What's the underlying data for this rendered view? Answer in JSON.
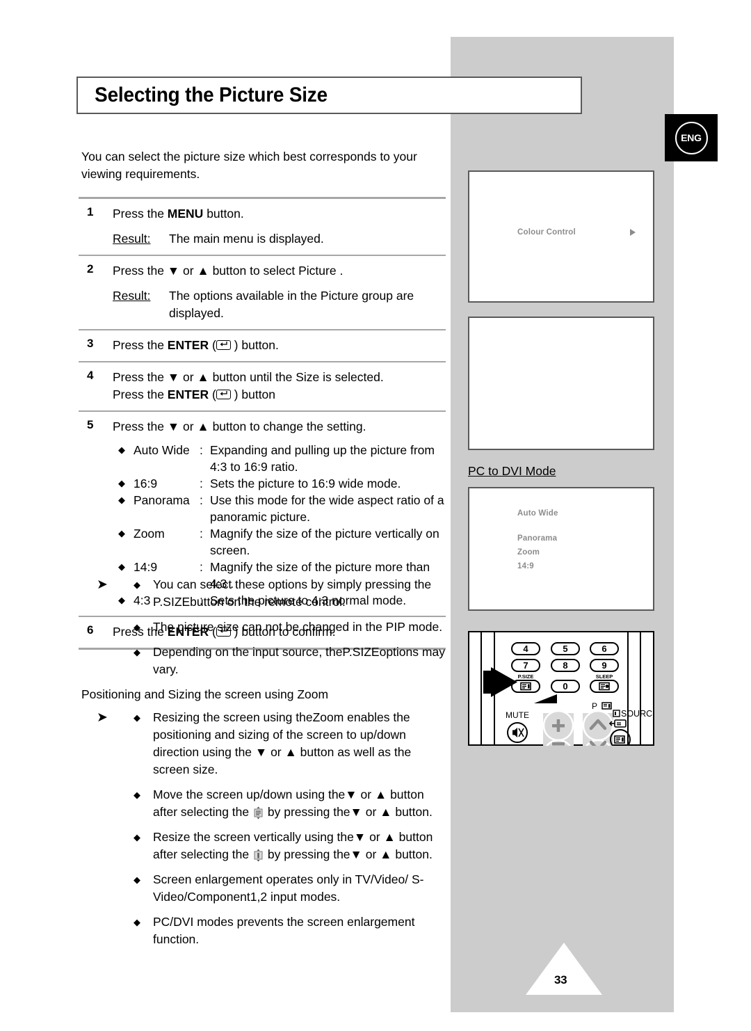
{
  "page": {
    "title": "Selecting the Picture Size",
    "number": "33",
    "language_badge": "ENG"
  },
  "intro": "You can select the picture size which best corresponds to your viewing requirements.",
  "steps": [
    {
      "number": "1",
      "instruction_pre": "Press the ",
      "instruction_bold": "MENU",
      "instruction_post": " button.",
      "result_label": "Result:",
      "result_text": "The main menu is displayed."
    },
    {
      "number": "2",
      "instruction": "Press the ▼ or ▲ button to select Picture    .",
      "result_label": "Result:",
      "result_text": "The options available in the Picture      group are displayed."
    },
    {
      "number": "3",
      "instruction_pre": "Press the ",
      "instruction_bold": "ENTER",
      "instruction_post": " ) button."
    },
    {
      "number": "4",
      "line1": "Press the ▼ or ▲ button until the Size   is selected.",
      "line2_pre": "Press the ",
      "line2_bold": "ENTER",
      "line2_post": " ) button"
    },
    {
      "number": "5",
      "instruction": "Press the ▼ or ▲ button to change the setting."
    },
    {
      "number": "6",
      "instruction_pre": "Press the ",
      "instruction_bold": "ENTER",
      "instruction_post": " ) button to confirm."
    }
  ],
  "size_options": [
    {
      "name": "Auto Wide",
      "desc": "Expanding and pulling up the picture from 4:3 to 16:9 ratio."
    },
    {
      "name": "16:9",
      "desc": "Sets the picture to 16:9 wide mode."
    },
    {
      "name": "Panorama",
      "desc": "Use this mode for the wide aspect ratio of a panoramic picture."
    },
    {
      "name": "Zoom",
      "desc": "Magnify the size of the picture vertically on screen."
    },
    {
      "name": "14:9",
      "desc": "Magnify the size of the picture more than 4:3 ."
    },
    {
      "name": "4:3",
      "desc": "Sets the picture to 4:3 normal mode."
    }
  ],
  "notes": [
    "You can select these options by simply pressing the P.SIZEbutton on the remote control.",
    "The picture size can not be changed in the PIP mode.",
    "Depending on the input source, theP.SIZEoptions may vary."
  ],
  "zoom_section": {
    "heading": "Positioning and Sizing the screen using Zoom",
    "notes": [
      "Resizing the screen using theZoom enables the positioning and sizing of the screen to up/down direction using the ▼ or ▲ button as well as the screen size.",
      "Move the screen up/down using the▼ or ▲ button after selecting the ",
      "Resize the screen vertically using the▼ or ▲ button after selecting the ",
      "Screen enlargement operates only in TV/Video/ S-Video/Component1,2 input modes.",
      "PC/DVI modes prevents the screen enlargement function."
    ],
    "note2_tail": " by pressing the▼ or ▲ button.",
    "note3_tail": " by pressing the▼ or ▲ button."
  },
  "osd": {
    "box1": {
      "label": "Colour Control"
    },
    "box2": {
      "label": ""
    },
    "pc_to_dvi_label": "PC to DVI Mode",
    "box3": {
      "items": [
        "Auto Wide",
        "Panorama",
        "Zoom",
        "14:9"
      ]
    }
  },
  "remote": {
    "keys": [
      "4",
      "5",
      "6",
      "7",
      "8",
      "9",
      "0"
    ],
    "psize_label": "P.SIZE",
    "sleep_label": "SLEEP",
    "mute_label": "MUTE",
    "channel_label": "P",
    "source_label": "SOURCE"
  },
  "colors": {
    "panel_grey": "#cccccc",
    "osd_text": "#8c8c8c",
    "rule": "#a6a6a6",
    "border": "#595959"
  }
}
